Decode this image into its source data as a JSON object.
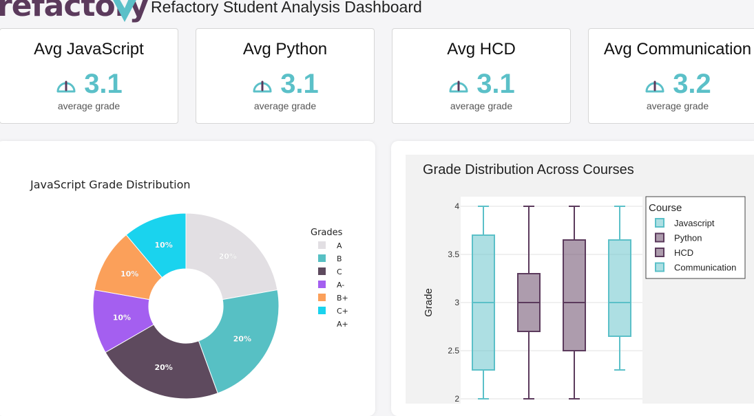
{
  "header": {
    "logo_text": "refactory",
    "title": "Refactory Student Analysis Dashboard"
  },
  "cards": [
    {
      "title": "Avg JavaScript",
      "value": "3.1",
      "subtitle": "average grade",
      "icon": "gauge-icon"
    },
    {
      "title": "Avg Python",
      "value": "3.1",
      "subtitle": "average grade",
      "icon": "gauge-icon"
    },
    {
      "title": "Avg HCD",
      "value": "3.1",
      "subtitle": "average grade",
      "icon": "gauge-icon"
    },
    {
      "title": "Avg Communication",
      "value": "3.2",
      "subtitle": "average grade",
      "icon": "gauge-icon"
    }
  ],
  "colors": {
    "accent": "#5bc0c8",
    "brand": "#5b3a5c"
  },
  "chart_data": [
    {
      "type": "pie",
      "title": "JavaScript Grade Distribution",
      "hole": 0.4,
      "legend_title": "Grades",
      "legend_placement": "right",
      "labels": [
        "A",
        "B",
        "C",
        "A-",
        "B+",
        "C+",
        "A+"
      ],
      "values": [
        20,
        20,
        20,
        10,
        10,
        10,
        0
      ],
      "slice_labels": [
        "20%",
        "20%",
        "20%",
        "10%",
        "10%",
        "10%",
        ""
      ],
      "colors": [
        "#e2dfe3",
        "#57c0c4",
        "#5e4a5e",
        "#a45ff0",
        "#fba05a",
        "#1ad3ee",
        "#ffffff"
      ]
    },
    {
      "type": "box",
      "title": "Grade Distribution Across Courses",
      "ylabel": "Grade",
      "xlabel": "",
      "ylim": [
        2,
        4
      ],
      "yticks": [
        2,
        2.5,
        3,
        3.5,
        4
      ],
      "ytick_labels": [
        "2",
        "2.5",
        "3",
        "3.5",
        "4"
      ],
      "grid": true,
      "legend_title": "Course",
      "legend_placement": "top-right",
      "series": [
        {
          "name": "Javascript",
          "min": 2,
          "q1": 2.3,
          "median": 3,
          "q3": 3.7,
          "max": 4,
          "color": "#5bc0c8"
        },
        {
          "name": "Python",
          "min": 2,
          "q1": 2.7,
          "median": 3,
          "q3": 3.3,
          "max": 4,
          "color": "#5b3a5c"
        },
        {
          "name": "HCD",
          "min": 2,
          "q1": 2.5,
          "median": 3,
          "q3": 3.65,
          "max": 4,
          "color": "#5b3a5c"
        },
        {
          "name": "Communication",
          "min": 2.3,
          "q1": 2.65,
          "median": 3,
          "q3": 3.65,
          "max": 4,
          "color": "#5bc0c8"
        }
      ]
    }
  ]
}
